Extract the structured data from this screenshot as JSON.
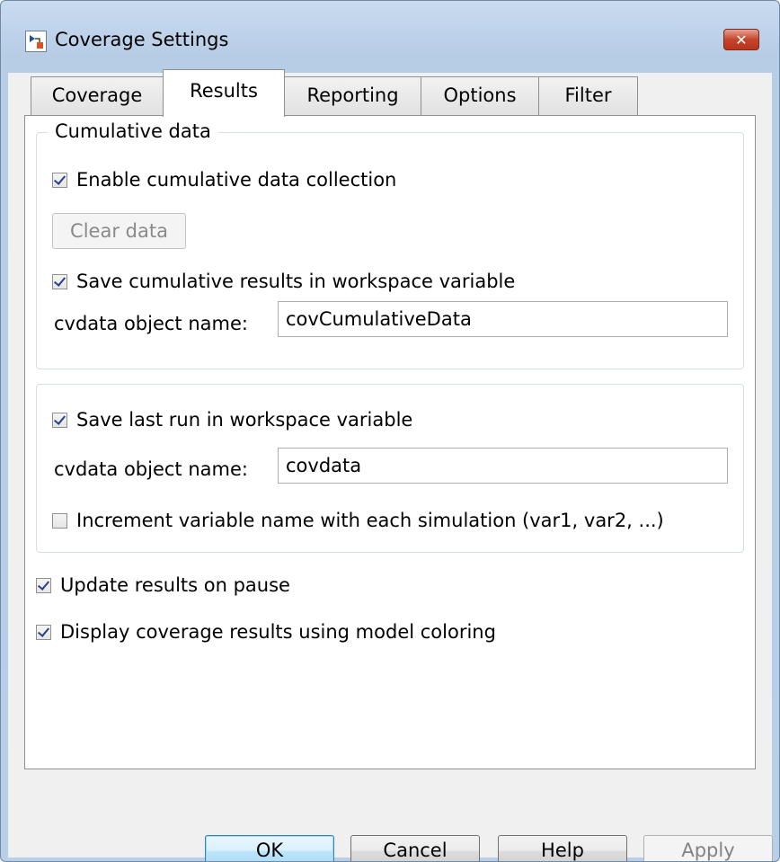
{
  "window": {
    "title": "Coverage Settings",
    "close_glyph": "✕"
  },
  "tabs": [
    {
      "label": "Coverage",
      "active": false
    },
    {
      "label": "Results",
      "active": true
    },
    {
      "label": "Reporting",
      "active": false
    },
    {
      "label": "Options",
      "active": false
    },
    {
      "label": "Filter",
      "active": false
    }
  ],
  "cumulative": {
    "group_title": "Cumulative data",
    "enable_label": "Enable cumulative data collection",
    "enable_checked": true,
    "clear_button": "Clear data",
    "save_label": "Save cumulative results in workspace variable",
    "save_checked": true,
    "name_label": "cvdata object name:",
    "name_value": "covCumulativeData"
  },
  "lastrun": {
    "save_label": "Save last run in workspace variable",
    "save_checked": true,
    "name_label": "cvdata object name:",
    "name_value": "covdata",
    "increment_label": "Increment variable name with each simulation (var1, var2, ...)",
    "increment_checked": false
  },
  "options": {
    "update_label": "Update results on pause",
    "update_checked": true,
    "display_label": "Display coverage results using model coloring",
    "display_checked": true
  },
  "buttons": {
    "ok": "OK",
    "cancel": "Cancel",
    "help": "Help",
    "apply": "Apply"
  }
}
